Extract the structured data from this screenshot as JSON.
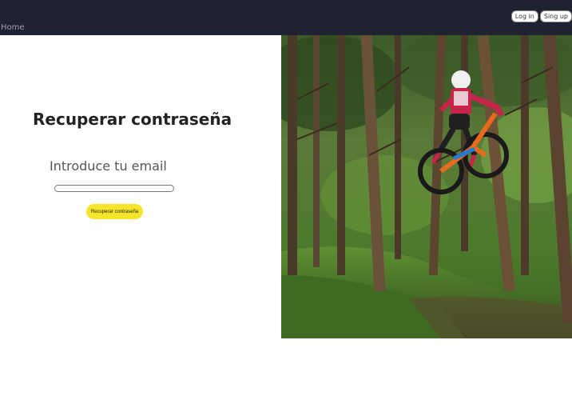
{
  "nav": {
    "home": "Home",
    "login": "Log in",
    "signup": "Sing up"
  },
  "form": {
    "title": "Recuperar contraseña",
    "email_label": "Introduce tu email",
    "email_value": "",
    "submit": "Recuperar contraseña"
  },
  "colors": {
    "topbar": "#1f2230",
    "button": "#f6e52a"
  }
}
